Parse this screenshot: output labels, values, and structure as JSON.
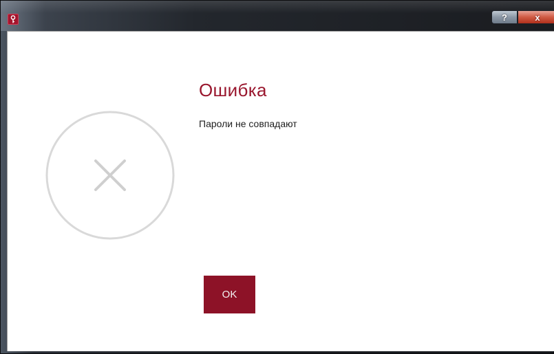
{
  "window": {
    "app_icon": "key-icon",
    "help_label": "?",
    "close_label": "x",
    "colors": {
      "accent": "#8d1227",
      "title": "#99162d",
      "icon_gray": "#d4d4d4"
    }
  },
  "dialog": {
    "status_icon": "error-x-icon",
    "title": "Ошибка",
    "message": "Пароли не совпадают",
    "ok_label": "OK"
  }
}
